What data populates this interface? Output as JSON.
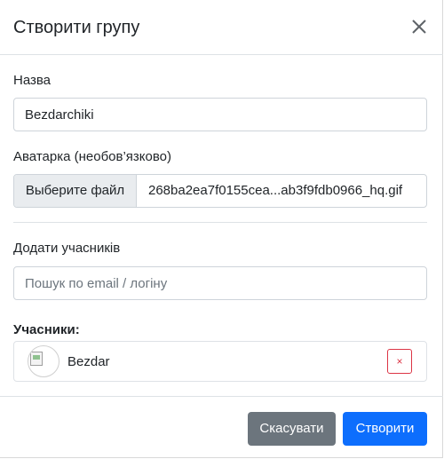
{
  "modal": {
    "title": "Створити групу",
    "close_icon": "close-icon"
  },
  "form": {
    "name_label": "Назва",
    "name_value": "Bezdarchiki",
    "avatar_label": "Аватарка (необов’язково)",
    "file_button_label": "Выберите файл",
    "file_name": "268ba2ea7f0155cea...ab3f9fdb0966_hq.gif",
    "add_members_label": "Додати учасників",
    "search_placeholder": "Пошук по email / логіну",
    "search_value": ""
  },
  "members": {
    "label": "Учасники:",
    "items": [
      {
        "name": "Bezdar",
        "avatar_icon": "broken-image-icon",
        "remove_symbol": "×"
      }
    ]
  },
  "footer": {
    "cancel_label": "Скасувати",
    "create_label": "Створити"
  },
  "colors": {
    "primary": "#0d6efd",
    "secondary": "#6c757d",
    "danger": "#dc3545",
    "border": "#ced4da"
  }
}
